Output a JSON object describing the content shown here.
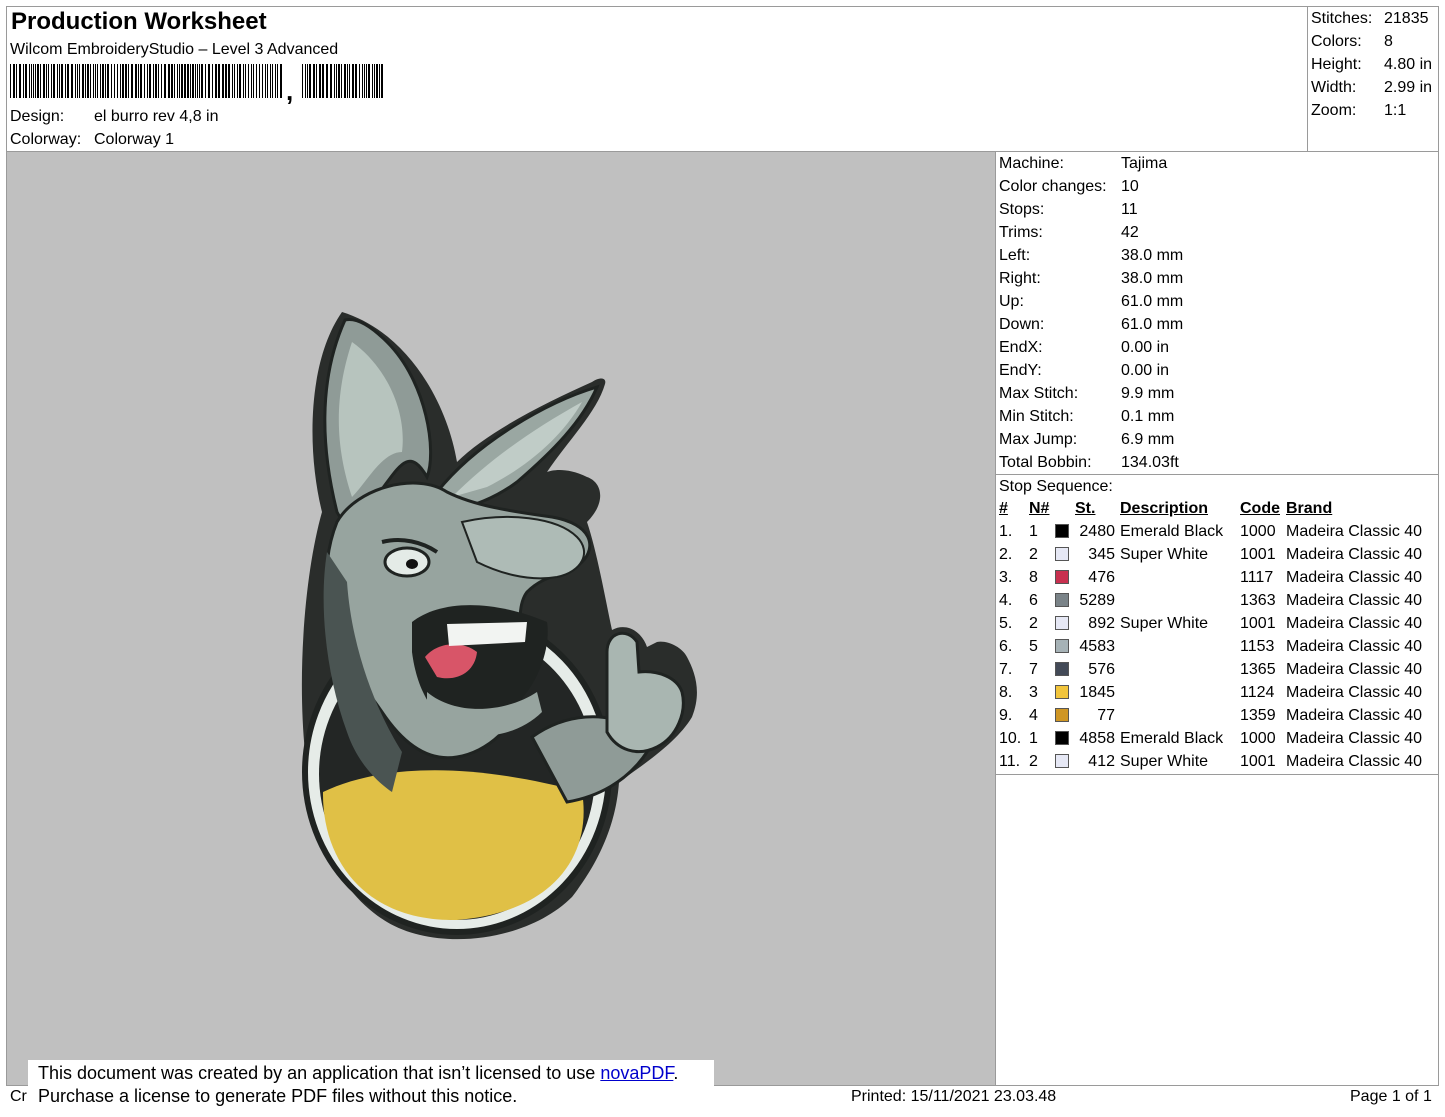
{
  "header": {
    "title": "Production Worksheet",
    "software": "Wilcom EmbroideryStudio – Level 3 Advanced",
    "barcode_suffix": ",",
    "design_label": "Design:",
    "design_value": "el burro rev 4,8 in",
    "colorway_label": "Colorway:",
    "colorway_value": "Colorway 1"
  },
  "summary": [
    {
      "label": "Stitches:",
      "value": "21835"
    },
    {
      "label": "Colors:",
      "value": "8"
    },
    {
      "label": "Height:",
      "value": "4.80 in"
    },
    {
      "label": "Width:",
      "value": "2.99 in"
    },
    {
      "label": "Zoom:",
      "value": "1:1"
    }
  ],
  "machine_info": [
    {
      "label": "Machine:",
      "value": "Tajima"
    },
    {
      "label": "Color changes:",
      "value": "10"
    },
    {
      "label": "Stops:",
      "value": "11"
    },
    {
      "label": "Trims:",
      "value": "42"
    },
    {
      "label": "Left:",
      "value": "38.0 mm"
    },
    {
      "label": "Right:",
      "value": "38.0 mm"
    },
    {
      "label": "Up:",
      "value": "61.0 mm"
    },
    {
      "label": "Down:",
      "value": "61.0 mm"
    },
    {
      "label": "EndX:",
      "value": "0.00 in"
    },
    {
      "label": "EndY:",
      "value": "0.00 in"
    },
    {
      "label": "Max Stitch:",
      "value": "9.9 mm"
    },
    {
      "label": "Min Stitch:",
      "value": "0.1 mm"
    },
    {
      "label": "Max Jump:",
      "value": "6.9 mm"
    },
    {
      "label": "Total Bobbin:",
      "value": "134.03ft"
    }
  ],
  "stop_sequence": {
    "title": "Stop Sequence:",
    "headers": {
      "num": "#",
      "n": "N#",
      "st": "St.",
      "description": "Description",
      "code": "Code",
      "brand": "Brand"
    },
    "rows": [
      {
        "num": "1.",
        "n": "1",
        "color": "#000000",
        "st": "2480",
        "description": "Emerald Black",
        "code": "1000",
        "brand": "Madeira Classic 40"
      },
      {
        "num": "2.",
        "n": "2",
        "color": "#e6e8f5",
        "st": "345",
        "description": "Super White",
        "code": "1001",
        "brand": "Madeira Classic 40"
      },
      {
        "num": "3.",
        "n": "8",
        "color": "#c8304f",
        "st": "476",
        "description": "",
        "code": "1117",
        "brand": "Madeira Classic 40"
      },
      {
        "num": "4.",
        "n": "6",
        "color": "#7a8388",
        "st": "5289",
        "description": "",
        "code": "1363",
        "brand": "Madeira Classic 40"
      },
      {
        "num": "5.",
        "n": "2",
        "color": "#e6e8f5",
        "st": "892",
        "description": "Super White",
        "code": "1001",
        "brand": "Madeira Classic 40"
      },
      {
        "num": "6.",
        "n": "5",
        "color": "#a6b2b6",
        "st": "4583",
        "description": "",
        "code": "1153",
        "brand": "Madeira Classic 40"
      },
      {
        "num": "7.",
        "n": "7",
        "color": "#434a57",
        "st": "576",
        "description": "",
        "code": "1365",
        "brand": "Madeira Classic 40"
      },
      {
        "num": "8.",
        "n": "3",
        "color": "#f2c53c",
        "st": "1845",
        "description": "",
        "code": "1124",
        "brand": "Madeira Classic 40"
      },
      {
        "num": "9.",
        "n": "4",
        "color": "#cf9624",
        "st": "77",
        "description": "",
        "code": "1359",
        "brand": "Madeira Classic 40"
      },
      {
        "num": "10.",
        "n": "1",
        "color": "#000000",
        "st": "4858",
        "description": "Emerald Black",
        "code": "1000",
        "brand": "Madeira Classic 40"
      },
      {
        "num": "11.",
        "n": "2",
        "color": "#e6e8f5",
        "st": "412",
        "description": "Super White",
        "code": "1001",
        "brand": "Madeira Classic 40"
      }
    ]
  },
  "footer": {
    "left_clip": "Cr",
    "printed": "Printed: 15/11/2021 23.03.48",
    "page": "Page 1 of 1"
  },
  "notice": {
    "line1_pre": "This document was created by an application that isn’t licensed to use ",
    "link": "novaPDF",
    "line1_post": ".",
    "line2": "Purchase a license to generate PDF files without this notice."
  }
}
